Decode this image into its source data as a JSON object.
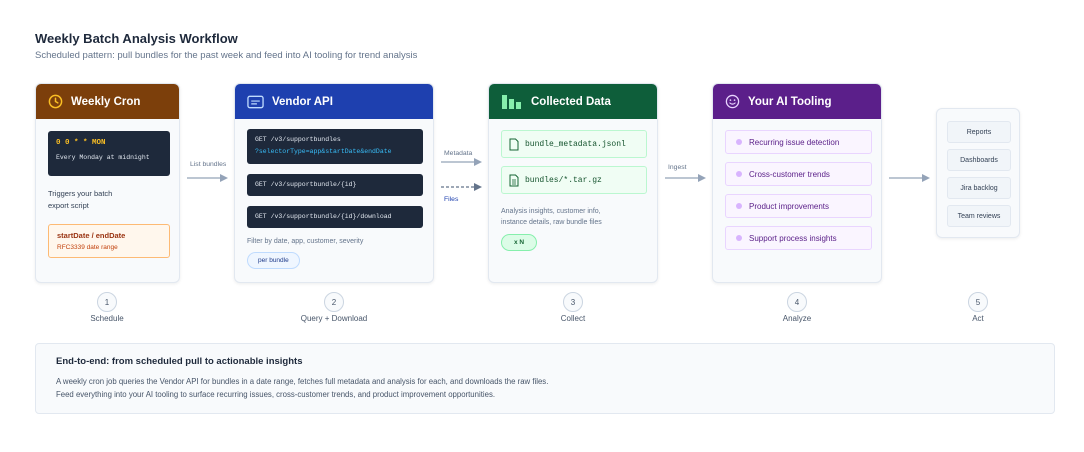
{
  "header": {
    "title": "Weekly Batch Analysis Workflow",
    "subtitle": "Scheduled pattern: pull bundles for the past week and feed into AI tooling for trend analysis"
  },
  "colors": {
    "cron": "#7c3f0b",
    "api": "#1e40af",
    "collect": "#0e5e3a",
    "ai": "#5b1f8a"
  },
  "cron": {
    "title": "Weekly Cron",
    "icon": "clock-icon",
    "code": "0 0 * * MON",
    "code_note": "Every Monday at midnight",
    "desc_line1": "Triggers your batch",
    "desc_line2": "export script",
    "range_title": "startDate / endDate",
    "range_note": "RFC3339 date range"
  },
  "api": {
    "title": "Vendor API",
    "icon": "api-window-icon",
    "endpoint1": "GET /v3/supportbundles",
    "endpoint1_param": "?selectorType=app&startDate&endDate",
    "endpoint2": "GET /v3/supportbundle/{id}",
    "endpoint3": "GET /v3/supportbundle/{id}/download",
    "filter_note": "Filter by date, app, customer, severity",
    "badge": "per bundle"
  },
  "collect": {
    "title": "Collected Data",
    "icon": "bar-chart-icon",
    "file1": "bundle_metadata.jsonl",
    "file2": "bundles/*.tar.gz",
    "note_line1": "Analysis insights, customer info,",
    "note_line2": "instance details, raw bundle files",
    "badge": "x N"
  },
  "ai": {
    "title": "Your AI Tooling",
    "icon": "smiley-robot-icon",
    "items": [
      "Recurring issue detection",
      "Cross-customer trends",
      "Product improvements",
      "Support process insights"
    ]
  },
  "act": {
    "items": [
      "Reports",
      "Dashboards",
      "Jira backlog",
      "Team reviews"
    ]
  },
  "arrows": {
    "list_bundles": "List bundles",
    "metadata": "Metadata",
    "files": "Files",
    "ingest": "Ingest"
  },
  "steps": [
    {
      "num": "1",
      "label": "Schedule"
    },
    {
      "num": "2",
      "label": "Query + Download"
    },
    {
      "num": "3",
      "label": "Collect"
    },
    {
      "num": "4",
      "label": "Analyze"
    },
    {
      "num": "5",
      "label": "Act"
    }
  ],
  "footer": {
    "title": "End-to-end: from scheduled pull to actionable insights",
    "line1": "A weekly cron job queries the Vendor API for bundles in a date range, fetches full metadata and analysis for each, and downloads the raw files.",
    "line2": "Feed everything into your AI tooling to surface recurring issues, cross-customer trends, and product improvement opportunities."
  }
}
